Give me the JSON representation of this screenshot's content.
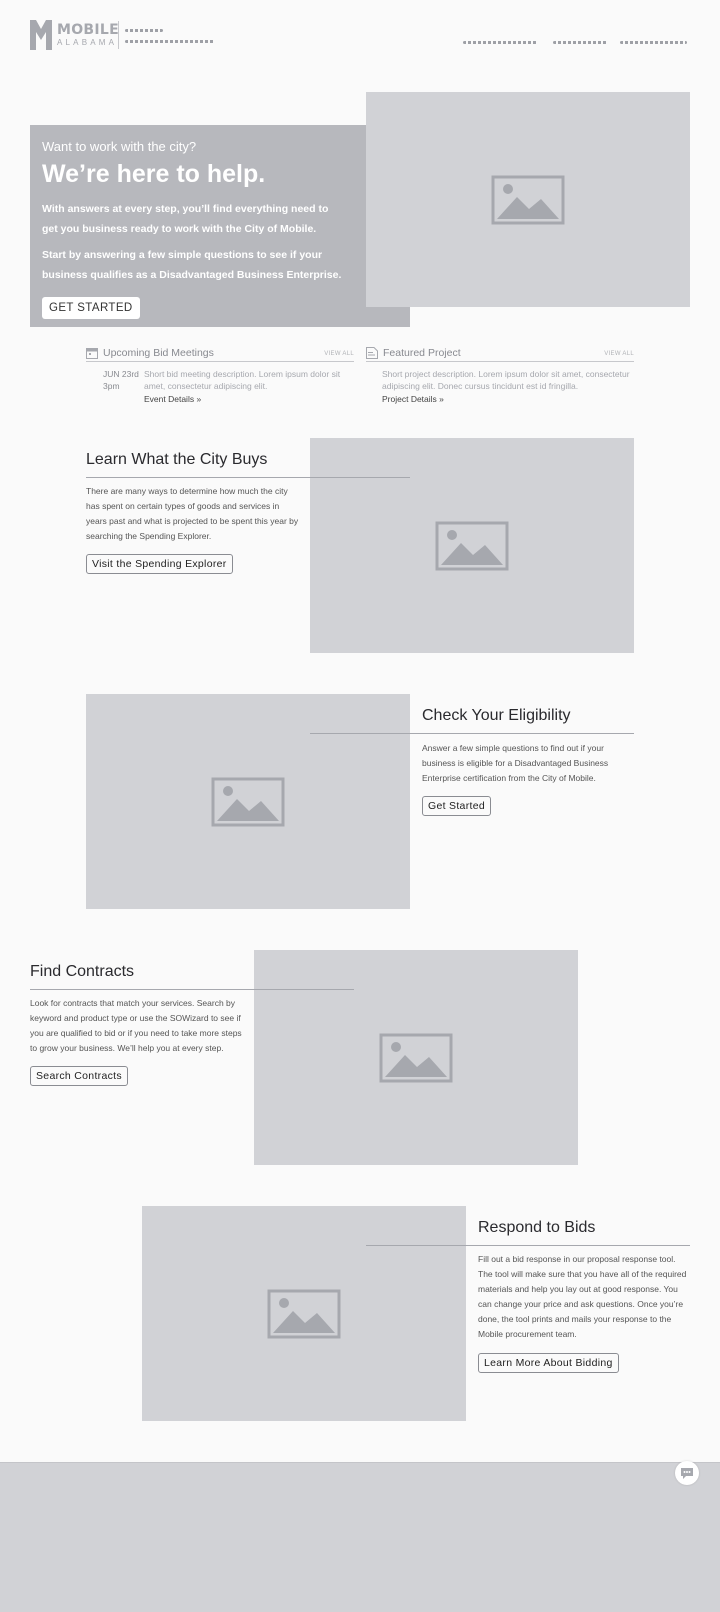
{
  "header": {
    "logo_word": "MOBILE",
    "logo_sub": "ALABAMA"
  },
  "hero": {
    "kicker": "Want to work with the city?",
    "title": "We’re here to help.",
    "text1": "With answers at every step, you’ll find everything need to get you business ready to work with the City of Mobile.",
    "text2": "Start by answering a few simple questions to see if your business qualifies as a Disadvantaged Business Enterprise.",
    "button": "GET STARTED"
  },
  "bid_meetings": {
    "title": "Upcoming Bid Meetings",
    "view_all": "VIEW ALL",
    "date": "JUN 23rd",
    "time": "3pm",
    "description": "Short bid meeting description. Lorem ipsum dolor sit amet, consectetur adipiscing elit.",
    "link": "Event Details »"
  },
  "featured_project": {
    "title": "Featured Project",
    "view_all": "VIEW ALL",
    "description": "Short project description. Lorem ipsum dolor sit amet, consectetur adipiscing elit. Donec cursus tincidunt est id fringilla.",
    "link": "Project Details »"
  },
  "sections": [
    {
      "title": "Learn What the City Buys",
      "text": "There are many ways to determine how much the city has spent on certain types of goods and services in years past and what is projected to be spent this year by searching the Spending Explorer.",
      "button": "Visit the Spending Explorer"
    },
    {
      "title": "Check Your Eligibility",
      "text": "Answer a few simple questions to find out if your business is eligible for a Disadvantaged Business Enterprise certification from the City of Mobile.",
      "button": "Get Started"
    },
    {
      "title": "Find Contracts",
      "text": "Look for contracts that match your services. Search by keyword and product type or use the SOWizard to see if you are qualified to bid or if you need to take more steps to grow your business. We’ll help you at every step.",
      "button": "Search Contracts"
    },
    {
      "title": "Respond to Bids",
      "text": "Fill out a bid response in our proposal response tool. The tool will make sure that you have all of the required materials and help you lay out at good response. You can change your price and ask questions. Once you’re done, the tool prints and mails your response to the Mobile procurement team.",
      "button": "Learn More About Bidding"
    }
  ],
  "colors": {
    "placeholder": "#d1d2d6",
    "hero_box": "#b7b8bd",
    "rule": "#a6a8ae"
  },
  "icons": [
    "mobile-logo-icon",
    "calendar-icon",
    "document-icon",
    "image-placeholder-icon",
    "chat-icon"
  ]
}
